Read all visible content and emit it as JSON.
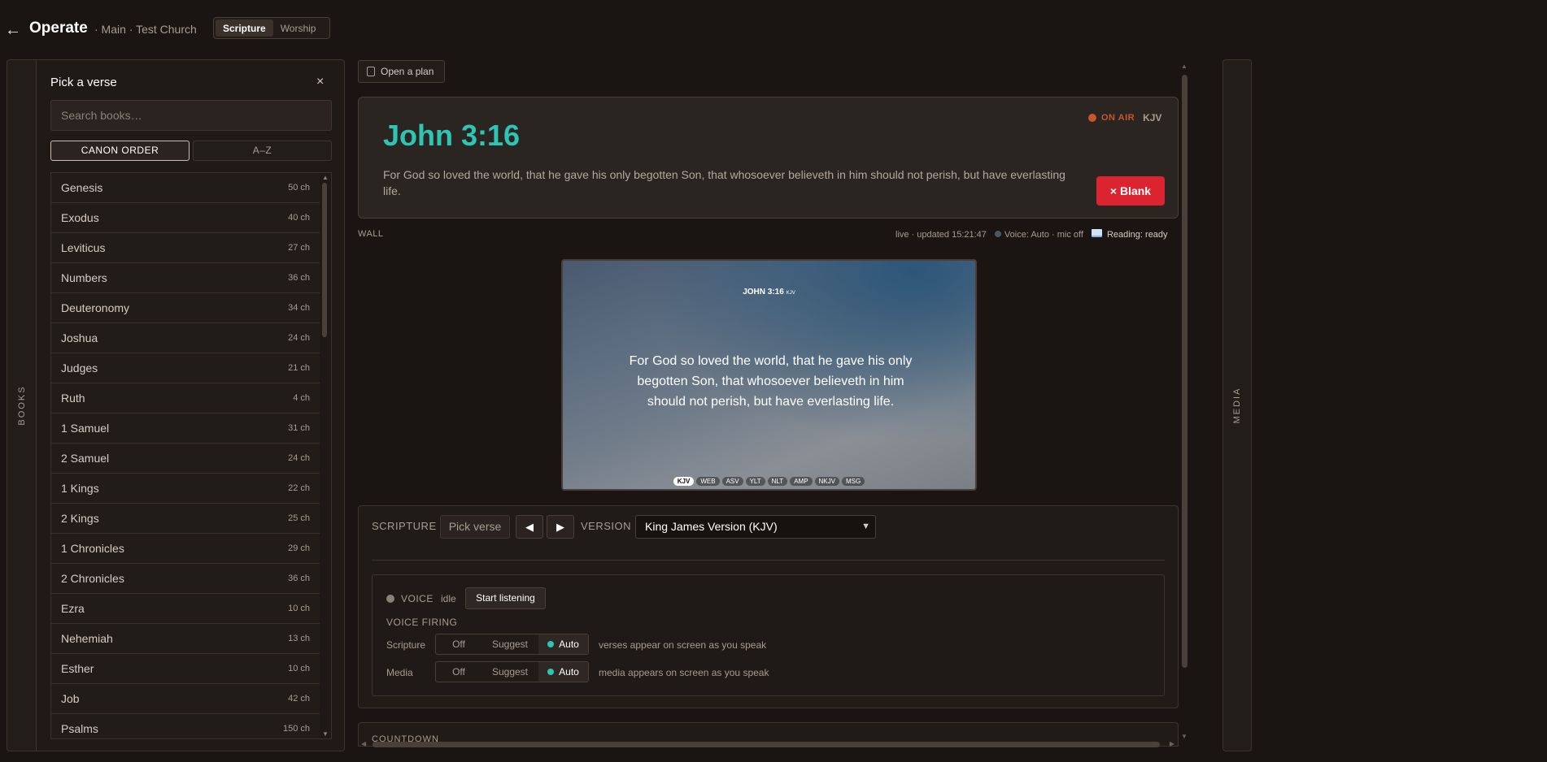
{
  "header": {
    "back_icon": "arrow-left-icon",
    "title": "Operate",
    "breadcrumb": "· Main · Test Church",
    "modes": [
      {
        "label": "Scripture",
        "active": true
      },
      {
        "label": "Worship",
        "active": false
      }
    ]
  },
  "left_rail": {
    "label": "BOOKS"
  },
  "right_rail": {
    "label": "MEDIA"
  },
  "books_panel": {
    "title": "Pick a verse",
    "close_label": "×",
    "search_placeholder": "Search books…",
    "sort": [
      {
        "label": "CANON ORDER",
        "active": true
      },
      {
        "label": "A–Z",
        "active": false
      }
    ],
    "books": [
      {
        "name": "Genesis",
        "chapters": "50 ch"
      },
      {
        "name": "Exodus",
        "chapters": "40 ch"
      },
      {
        "name": "Leviticus",
        "chapters": "27 ch"
      },
      {
        "name": "Numbers",
        "chapters": "36 ch"
      },
      {
        "name": "Deuteronomy",
        "chapters": "34 ch"
      },
      {
        "name": "Joshua",
        "chapters": "24 ch"
      },
      {
        "name": "Judges",
        "chapters": "21 ch"
      },
      {
        "name": "Ruth",
        "chapters": "4 ch"
      },
      {
        "name": "1 Samuel",
        "chapters": "31 ch"
      },
      {
        "name": "2 Samuel",
        "chapters": "24 ch"
      },
      {
        "name": "1 Kings",
        "chapters": "22 ch"
      },
      {
        "name": "2 Kings",
        "chapters": "25 ch"
      },
      {
        "name": "1 Chronicles",
        "chapters": "29 ch"
      },
      {
        "name": "2 Chronicles",
        "chapters": "36 ch"
      },
      {
        "name": "Ezra",
        "chapters": "10 ch"
      },
      {
        "name": "Nehemiah",
        "chapters": "13 ch"
      },
      {
        "name": "Esther",
        "chapters": "10 ch"
      },
      {
        "name": "Job",
        "chapters": "42 ch"
      },
      {
        "name": "Psalms",
        "chapters": "150 ch"
      }
    ]
  },
  "plan_button": {
    "label": "Open a plan",
    "icon": "clipboard-icon"
  },
  "live": {
    "reference": "John 3:16",
    "text": "For God so loved the world, that he gave his only begotten Son, that whosoever believeth in him should not perish, but have everlasting life.",
    "on_air_label": "ON AIR",
    "version": "KJV",
    "blank_label": "× Blank",
    "on_air_color": "#c8552e",
    "accent_color": "#2ec4b6",
    "blank_color": "#dc2430"
  },
  "wall": {
    "label": "WALL",
    "updated": "live · updated 15:21:47",
    "voice_status": "Voice: Auto · mic off",
    "reading_status": "Reading: ready"
  },
  "preview": {
    "reference": "JOHN 3:16",
    "version_tag": "KJV",
    "text": "For God so loved the world, that he gave his only begotten Son, that whosoever believeth in him should not perish, but have everlasting life.",
    "versions": [
      {
        "label": "KJV",
        "active": true
      },
      {
        "label": "WEB",
        "active": false
      },
      {
        "label": "ASV",
        "active": false
      },
      {
        "label": "YLT",
        "active": false
      },
      {
        "label": "NLT",
        "active": false
      },
      {
        "label": "AMP",
        "active": false
      },
      {
        "label": "NKJV",
        "active": false
      },
      {
        "label": "MSG",
        "active": false
      }
    ]
  },
  "controls": {
    "scripture_label": "SCRIPTURE",
    "pick_label": "Pick verse",
    "prev_label": "◀",
    "next_label": "▶",
    "version_label": "VERSION",
    "version_selected": "King James Version (KJV)",
    "voice": {
      "title": "VOICE",
      "state": "idle",
      "listen_label": "Start listening",
      "firing_title": "VOICE FIRING",
      "rows": [
        {
          "label": "Scripture",
          "options": [
            "Off",
            "Suggest",
            "Auto"
          ],
          "selected": "Auto",
          "hint": "verses appear on screen as you speak"
        },
        {
          "label": "Media",
          "options": [
            "Off",
            "Suggest",
            "Auto"
          ],
          "selected": "Auto",
          "hint": "media appears on screen as you speak"
        }
      ]
    }
  },
  "countdown": {
    "label": "COUNTDOWN"
  }
}
